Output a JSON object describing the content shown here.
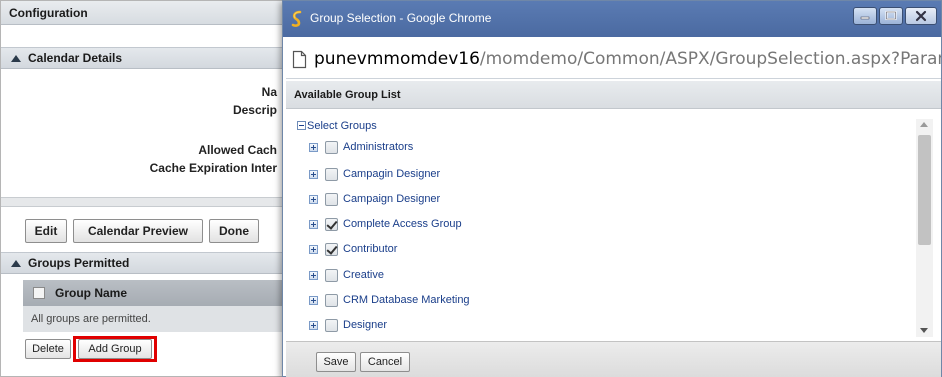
{
  "config": {
    "title": "Configuration",
    "calendar_details_label": "Calendar Details",
    "fields": [
      {
        "label": "Na"
      },
      {
        "label": "Descrip"
      },
      {
        "label": "Allowed Cach"
      },
      {
        "label": "Cache Expiration Inter"
      }
    ],
    "buttons": {
      "edit": "Edit",
      "calendar_preview": "Calendar Preview",
      "done": "Done"
    },
    "groups_permitted_label": "Groups Permitted",
    "grid": {
      "column_header": "Group Name",
      "empty_message": "All groups are permitted."
    },
    "delete_label": "Delete",
    "add_group_label": "Add Group",
    "highlight_color": "#e00000"
  },
  "popup": {
    "window_title": "Group Selection - Google Chrome",
    "url_host": "punevmmomdev16",
    "url_path": "/momdemo/Common/ASPX/GroupSelection.aspx?Param=GqS",
    "list_header": "Available Group List",
    "root_label": "Select Groups",
    "groups": [
      {
        "label": "Administrators",
        "checked": false
      },
      {
        "label": "Campagin Designer",
        "checked": false
      },
      {
        "label": "Campaign Designer",
        "checked": false
      },
      {
        "label": "Complete Access Group",
        "checked": true
      },
      {
        "label": "Contributor",
        "checked": true
      },
      {
        "label": "Creative",
        "checked": false
      },
      {
        "label": "CRM Database Marketing",
        "checked": false
      },
      {
        "label": "Designer",
        "checked": false
      }
    ],
    "save_label": "Save",
    "cancel_label": "Cancel",
    "titlebar_color": "#5a7bb3"
  }
}
